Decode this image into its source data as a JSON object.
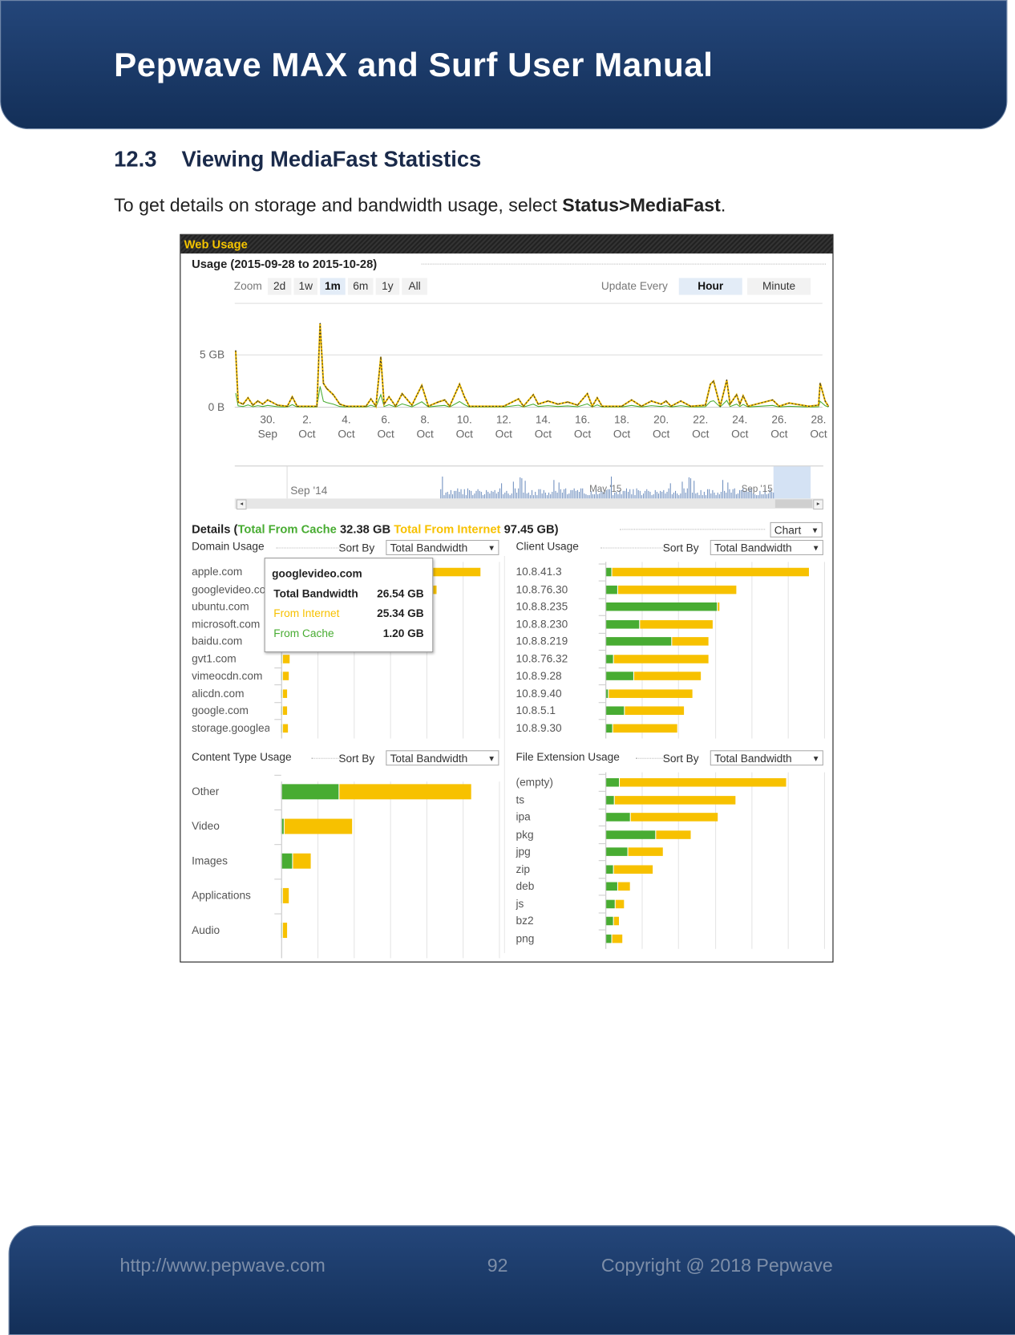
{
  "header": {
    "title": "Pepwave MAX and Surf User Manual"
  },
  "section": {
    "number": "12.3",
    "title": "Viewing MediaFast Statistics"
  },
  "intro": {
    "text": "To get details on storage and bandwidth usage, select ",
    "bold": "Status>MediaFast",
    "end": "."
  },
  "web_usage": {
    "title": "Web Usage",
    "usage_title": "Usage (2015-09-28 to 2015-10-28)",
    "zoom_label": "Zoom",
    "zoom_options": [
      "2d",
      "1w",
      "1m",
      "6m",
      "1y",
      "All"
    ],
    "zoom_selected": "1m",
    "update_label": "Update Every",
    "update_options": [
      "Hour",
      "Minute"
    ],
    "update_selected": "Hour",
    "colors": {
      "cache": "#48ac32",
      "internet": "#f7c100",
      "title": "#f5c400"
    },
    "chart_data": {
      "type": "line",
      "y_ticks": [
        "0 B",
        "5 GB"
      ],
      "x_ticks": [
        [
          "30.",
          "Sep"
        ],
        [
          "2.",
          "Oct"
        ],
        [
          "4.",
          "Oct"
        ],
        [
          "6.",
          "Oct"
        ],
        [
          "8.",
          "Oct"
        ],
        [
          "10.",
          "Oct"
        ],
        [
          "12.",
          "Oct"
        ],
        [
          "14.",
          "Oct"
        ],
        [
          "16.",
          "Oct"
        ],
        [
          "18.",
          "Oct"
        ],
        [
          "20.",
          "Oct"
        ],
        [
          "22.",
          "Oct"
        ],
        [
          "24.",
          "Oct"
        ],
        [
          "26.",
          "Oct"
        ],
        [
          "28.",
          "Oct"
        ]
      ],
      "unit": "GB",
      "points": [
        [
          "2015-09-28T09",
          5.4
        ],
        [
          "2015-09-28T12",
          0.5
        ],
        [
          "2015-09-28T18",
          0.3
        ],
        [
          "2015-09-29T00",
          0.9
        ],
        [
          "2015-09-29T06",
          0.2
        ],
        [
          "2015-09-29T12",
          0.6
        ],
        [
          "2015-09-29T18",
          0.3
        ],
        [
          "2015-09-30T00",
          0.7
        ],
        [
          "2015-09-30T12",
          0.2
        ],
        [
          "2015-10-01T00",
          0.1
        ],
        [
          "2015-10-01T06",
          1.0
        ],
        [
          "2015-10-01T12",
          0.1
        ],
        [
          "2015-10-02T12",
          0.1
        ],
        [
          "2015-10-02T16",
          8.0
        ],
        [
          "2015-10-02T20",
          2.3
        ],
        [
          "2015-10-03T00",
          1.8
        ],
        [
          "2015-10-03T08",
          1.2
        ],
        [
          "2015-10-03T16",
          0.3
        ],
        [
          "2015-10-04T00",
          0.1
        ],
        [
          "2015-10-05T00",
          0.1
        ],
        [
          "2015-10-05T06",
          0.8
        ],
        [
          "2015-10-05T12",
          0.1
        ],
        [
          "2015-10-05T18",
          4.8
        ],
        [
          "2015-10-05T22",
          0.3
        ],
        [
          "2015-10-06T04",
          1.0
        ],
        [
          "2015-10-06T12",
          0.1
        ],
        [
          "2015-10-06T20",
          1.3
        ],
        [
          "2015-10-07T08",
          0.2
        ],
        [
          "2015-10-07T20",
          2.1
        ],
        [
          "2015-10-08T04",
          0.1
        ],
        [
          "2015-10-08T16",
          0.5
        ],
        [
          "2015-10-09T00",
          0.7
        ],
        [
          "2015-10-09T06",
          0.1
        ],
        [
          "2015-10-09T18",
          2.2
        ],
        [
          "2015-10-10T00",
          1.0
        ],
        [
          "2015-10-10T06",
          0.1
        ],
        [
          "2015-10-12T00",
          0.1
        ],
        [
          "2015-10-12T18",
          0.8
        ],
        [
          "2015-10-13T00",
          0.1
        ],
        [
          "2015-10-13T12",
          1.2
        ],
        [
          "2015-10-13T18",
          0.3
        ],
        [
          "2015-10-14T06",
          0.6
        ],
        [
          "2015-10-14T18",
          0.3
        ],
        [
          "2015-10-15T06",
          0.5
        ],
        [
          "2015-10-15T18",
          0.2
        ],
        [
          "2015-10-16T06",
          1.3
        ],
        [
          "2015-10-16T12",
          0.1
        ],
        [
          "2015-10-16T18",
          0.9
        ],
        [
          "2015-10-17T00",
          0.1
        ],
        [
          "2015-10-18T00",
          0.1
        ],
        [
          "2015-10-18T12",
          0.7
        ],
        [
          "2015-10-19T00",
          0.1
        ],
        [
          "2015-10-19T12",
          0.6
        ],
        [
          "2015-10-20T00",
          0.3
        ],
        [
          "2015-10-20T06",
          0.6
        ],
        [
          "2015-10-20T12",
          0.1
        ],
        [
          "2015-10-21T00",
          0.6
        ],
        [
          "2015-10-21T12",
          0.1
        ],
        [
          "2015-10-22T06",
          0.2
        ],
        [
          "2015-10-22T12",
          2.2
        ],
        [
          "2015-10-22T16",
          2.5
        ],
        [
          "2015-10-23T00",
          0.1
        ],
        [
          "2015-10-23T08",
          2.6
        ],
        [
          "2015-10-23T12",
          0.3
        ],
        [
          "2015-10-23T20",
          1.2
        ],
        [
          "2015-10-24T00",
          0.3
        ],
        [
          "2015-10-24T04",
          1.1
        ],
        [
          "2015-10-24T10",
          0.1
        ],
        [
          "2015-10-25T16",
          0.7
        ],
        [
          "2015-10-26T00",
          0.1
        ],
        [
          "2015-10-26T12",
          0.4
        ],
        [
          "2015-10-27T12",
          0.1
        ],
        [
          "2015-10-28T00",
          0.2
        ],
        [
          "2015-10-28T02",
          2.3
        ],
        [
          "2015-10-28T08",
          0.6
        ],
        [
          "2015-10-28T12",
          0.1
        ]
      ],
      "navigator_labels": [
        "Sep '14",
        "May '15",
        "Sep '15"
      ]
    },
    "details": {
      "label": "Details (",
      "cache_label": "Total From Cache",
      "cache_value": "32.38 GB",
      "internet_label": "Total From Internet",
      "internet_value": "97.45 GB)",
      "view_select": "Chart"
    },
    "sort_label": "Sort By",
    "sort_value": "Total Bandwidth",
    "panels": {
      "domain": {
        "title": "Domain Usage",
        "rows": [
          {
            "label": "apple.com",
            "cache": 0.3,
            "internet": 33.8
          },
          {
            "label": "googlevideo.com",
            "cache": 1.2,
            "internet": 25.34
          },
          {
            "label": "ubuntu.com",
            "cache": 1.0,
            "internet": 14.0
          },
          {
            "label": "microsoft.com",
            "cache": 0.5,
            "internet": 9.5
          },
          {
            "label": "baidu.com",
            "cache": 0.3,
            "internet": 5.5
          },
          {
            "label": "gvt1.com",
            "cache": 0.1,
            "internet": 1.2
          },
          {
            "label": "vimeocdn.com",
            "cache": 0.2,
            "internet": 0.9
          },
          {
            "label": "alicdn.com",
            "cache": 0.2,
            "internet": 0.6
          },
          {
            "label": "google.com",
            "cache": 0.1,
            "internet": 0.8
          },
          {
            "label": "storage.googleapis.com",
            "cache": 0.1,
            "internet": 0.9
          }
        ]
      },
      "client": {
        "title": "Client Usage",
        "rows": [
          {
            "label": "10.8.41.3",
            "cache": 1.0,
            "internet": 33.8
          },
          {
            "label": "10.8.76.30",
            "cache": 2.0,
            "internet": 20.4
          },
          {
            "label": "10.8.8.235",
            "cache": 19.1,
            "internet": 0.4
          },
          {
            "label": "10.8.8.230",
            "cache": 5.8,
            "internet": 12.5
          },
          {
            "label": "10.8.8.219",
            "cache": 11.3,
            "internet": 6.2
          },
          {
            "label": "10.8.76.32",
            "cache": 1.3,
            "internet": 16.2
          },
          {
            "label": "10.8.9.28",
            "cache": 4.8,
            "internet": 11.5
          },
          {
            "label": "10.8.9.40",
            "cache": 0.4,
            "internet": 14.4
          },
          {
            "label": "10.8.5.1",
            "cache": 3.2,
            "internet": 10.2
          },
          {
            "label": "10.8.9.30",
            "cache": 1.2,
            "internet": 11.0
          }
        ]
      },
      "content": {
        "title": "Content Type Usage",
        "rows": [
          {
            "label": "Other",
            "cache": 9.9,
            "internet": 22.6
          },
          {
            "label": "Video",
            "cache": 0.4,
            "internet": 11.7
          },
          {
            "label": "Images",
            "cache": 1.9,
            "internet": 3.0
          },
          {
            "label": "Applications",
            "cache": 0.15,
            "internet": 1.0
          },
          {
            "label": "Audio",
            "cache": 0.15,
            "internet": 0.7
          }
        ]
      },
      "extension": {
        "title": "File Extension Usage",
        "rows": [
          {
            "label": "(empty)",
            "cache": 2.3,
            "internet": 28.6
          },
          {
            "label": "ts",
            "cache": 1.5,
            "internet": 20.7
          },
          {
            "label": "ipa",
            "cache": 4.2,
            "internet": 14.9
          },
          {
            "label": "pkg",
            "cache": 8.6,
            "internet": 5.9
          },
          {
            "label": "jpg",
            "cache": 3.8,
            "internet": 5.9
          },
          {
            "label": "zip",
            "cache": 1.3,
            "internet": 6.7
          },
          {
            "label": "deb",
            "cache": 2.0,
            "internet": 2.0
          },
          {
            "label": "js",
            "cache": 1.6,
            "internet": 1.5
          },
          {
            "label": "bz2",
            "cache": 1.3,
            "internet": 0.9
          },
          {
            "label": "png",
            "cache": 1.0,
            "internet": 1.7
          }
        ]
      }
    },
    "tooltip": {
      "title": "googlevideo.com",
      "total_label": "Total Bandwidth",
      "total_value": "26.54 GB",
      "internet_label": "From Internet",
      "internet_value": "25.34 GB",
      "cache_label": "From Cache",
      "cache_value": "1.20 GB"
    }
  },
  "footer": {
    "url": "http://www.pepwave.com",
    "page": "92",
    "copyright": "Copyright @ 2018 Pepwave"
  }
}
